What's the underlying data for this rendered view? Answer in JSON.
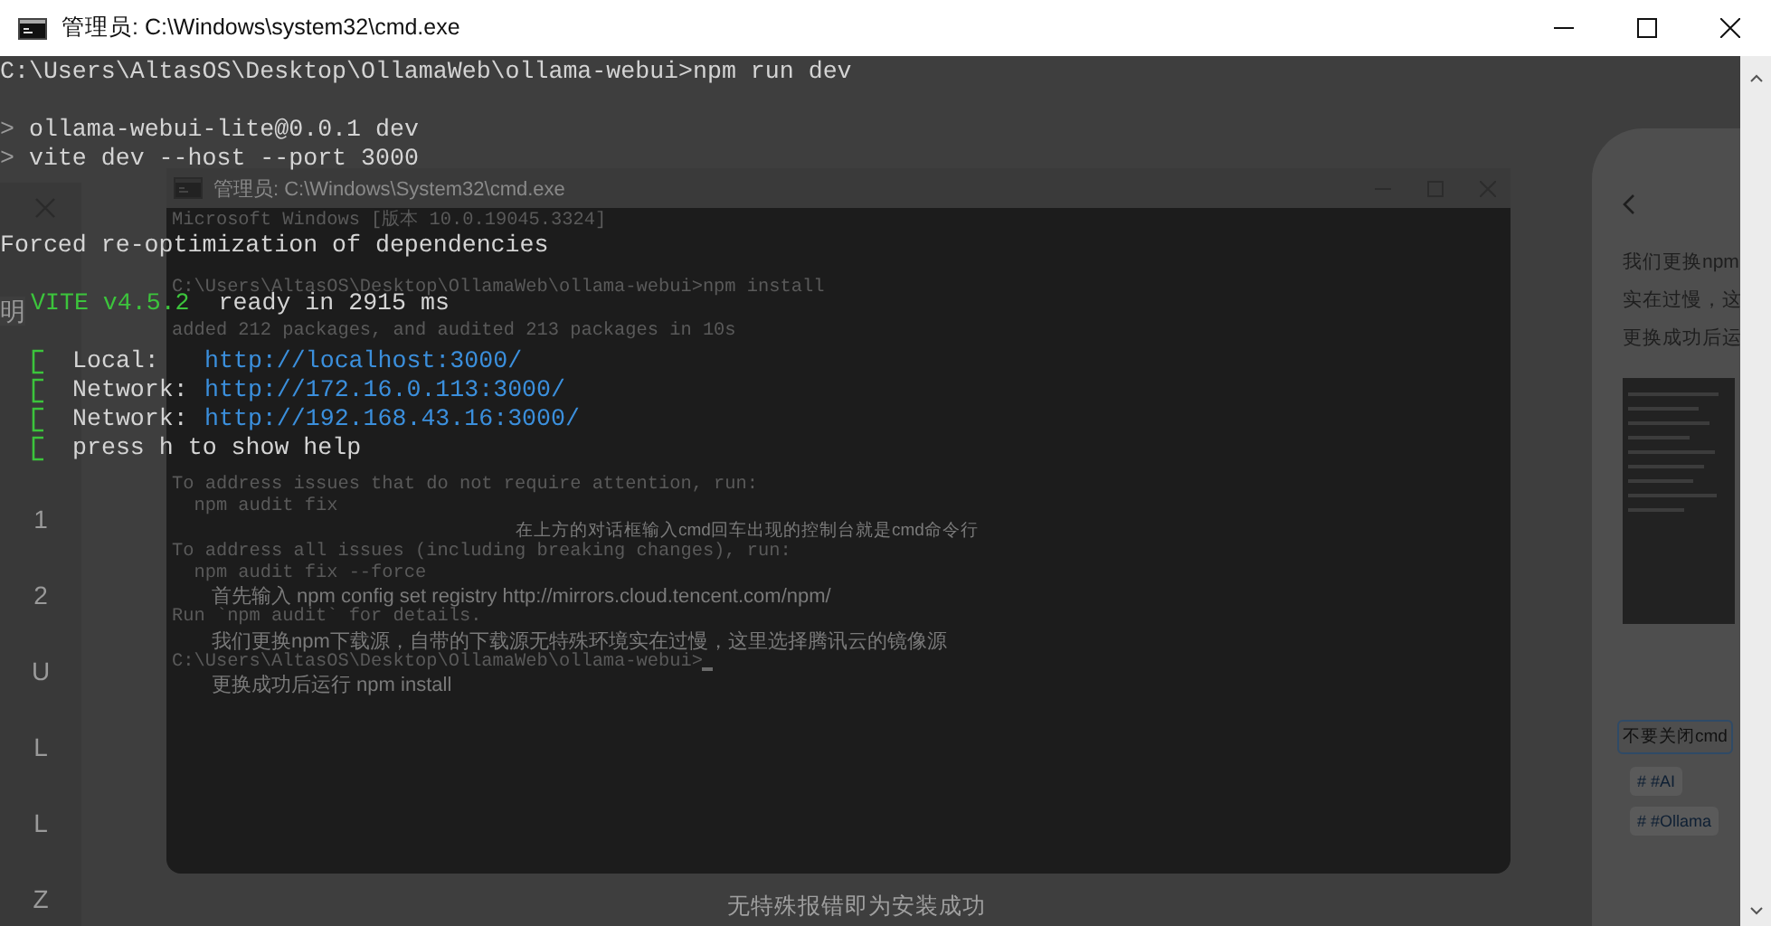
{
  "window": {
    "title": "管理员: C:\\Windows\\system32\\cmd.exe"
  },
  "terminal": {
    "lines": [
      {
        "kind": "plain",
        "text": "C:\\Users\\AltasOS\\Desktop\\OllamaWeb\\ollama-webui>npm run dev"
      },
      {
        "kind": "blank"
      },
      {
        "kind": "script",
        "marker": ">",
        "text": "ollama-webui-lite@0.0.1 dev"
      },
      {
        "kind": "script",
        "marker": ">",
        "text": "vite dev --host --port 3000"
      },
      {
        "kind": "blank"
      },
      {
        "kind": "blank"
      },
      {
        "kind": "plain",
        "text": "Forced re-optimization of dependencies"
      },
      {
        "kind": "blank"
      },
      {
        "kind": "banner",
        "name": "VITE v4.5.2",
        "text": "ready in 2915 ms"
      },
      {
        "kind": "blank"
      },
      {
        "kind": "url",
        "label": "Local:",
        "url": "http://localhost:3000/"
      },
      {
        "kind": "url",
        "label": "Network:",
        "url": "http://172.16.0.113:3000/"
      },
      {
        "kind": "url",
        "label": "Network:",
        "url": "http://192.168.43.16:3000/"
      },
      {
        "kind": "hint",
        "text": "press h to show help"
      }
    ]
  },
  "background": {
    "left_strip": {
      "cut_text": "明",
      "letters": [
        "1",
        "2",
        "U",
        "L",
        "L",
        "Z"
      ]
    },
    "inner_window": {
      "title": "管理员: C:\\Windows\\System32\\cmd.exe",
      "lines": [
        {
          "kind": "text",
          "text": "Microsoft Windows [版本 10.0.19045.3324]"
        },
        {
          "kind": "blank"
        },
        {
          "kind": "blank"
        },
        {
          "kind": "text",
          "text": "C:\\Users\\AltasOS\\Desktop\\OllamaWeb\\ollama-webui>npm install"
        },
        {
          "kind": "blank"
        },
        {
          "kind": "text",
          "text": "added 212 packages, and audited 213 packages in 10s"
        },
        {
          "kind": "blank"
        },
        {
          "kind": "blank"
        },
        {
          "kind": "blank"
        },
        {
          "kind": "blank"
        },
        {
          "kind": "blank"
        },
        {
          "kind": "blank"
        },
        {
          "kind": "text",
          "text": "To address issues that do not require attention, run:"
        },
        {
          "kind": "text",
          "text": "  npm audit fix"
        },
        {
          "kind": "note",
          "text": "在上方的对话框输入cmd回车出现的控制台就是cmd命令行"
        },
        {
          "kind": "text",
          "text": "To address all issues (including breaking changes), run:"
        },
        {
          "kind": "text",
          "text": "  npm audit fix --force"
        },
        {
          "kind": "article",
          "text": "首先输入 npm config set registry http://mirrors.cloud.tencent.com/npm/"
        },
        {
          "kind": "text",
          "text": "Run `npm audit` for details."
        },
        {
          "kind": "article",
          "text": "我们更换npm下载源，自带的下载源无特殊环境实在过慢，这里选择腾讯云的镜像源"
        },
        {
          "kind": "prompt",
          "text": "C:\\Users\\AltasOS\\Desktop\\OllamaWeb\\ollama-webui>"
        },
        {
          "kind": "article",
          "text": "更换成功后运行 npm install"
        }
      ]
    },
    "article_panel": {
      "paragraphs": [
        "我们更换npm",
        "实在过慢，这",
        "更换成功后运"
      ],
      "comment_box": {
        "value": "不要关闭cmd"
      },
      "tags": [
        "# #AI",
        "# #Ollama"
      ]
    },
    "caption": "无特殊报错即为安装成功"
  }
}
